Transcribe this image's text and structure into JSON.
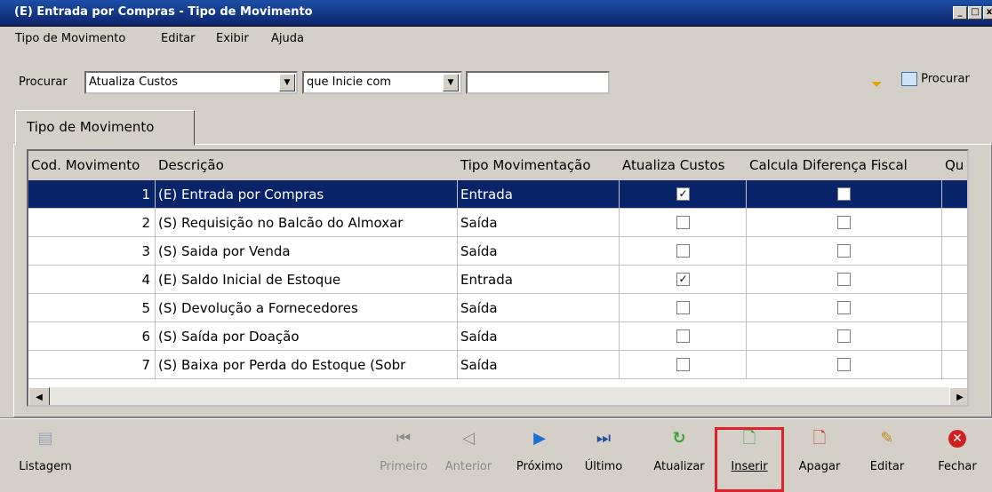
{
  "window": {
    "title": "(E) Entrada por Compras -  Tipo de Movimento"
  },
  "menu": [
    {
      "label": "Tipo de Movimento"
    },
    {
      "label": "Editar"
    },
    {
      "label": "Exibir"
    },
    {
      "label": "Ajuda"
    }
  ],
  "search": {
    "label": "Procurar",
    "field_value": "Atualiza Custos",
    "mode_value": "que Inicie com",
    "text_value": "",
    "button_label": "Procurar"
  },
  "tab": {
    "label": "Tipo de Movimento"
  },
  "grid": {
    "columns": [
      "Cod. Movimento",
      "Descrição",
      "Tipo Movimentação",
      "Atualiza Custos",
      "Calcula Diferença Fiscal",
      "Qu"
    ],
    "rows": [
      {
        "code": "1",
        "desc": "(E) Entrada por Compras",
        "tipo": "Entrada",
        "atualiza": true,
        "calcula": false,
        "selected": true
      },
      {
        "code": "2",
        "desc": "(S) Requisição no Balcão do Almoxar",
        "tipo": "Saída",
        "atualiza": false,
        "calcula": false
      },
      {
        "code": "3",
        "desc": "(S) Saida por Venda",
        "tipo": "Saída",
        "atualiza": false,
        "calcula": false
      },
      {
        "code": "4",
        "desc": "(E) Saldo Inicial de Estoque",
        "tipo": "Entrada",
        "atualiza": true,
        "calcula": false
      },
      {
        "code": "5",
        "desc": "(S) Devolução a Fornecedores",
        "tipo": "Saída",
        "atualiza": false,
        "calcula": false
      },
      {
        "code": "6",
        "desc": "(S) Saída por Doação",
        "tipo": "Saída",
        "atualiza": false,
        "calcula": false
      },
      {
        "code": "7",
        "desc": "(S) Baixa por Perda do Estoque (Sobr",
        "tipo": "Saída",
        "atualiza": false,
        "calcula": false
      }
    ]
  },
  "toolbar": {
    "listagem": "Listagem",
    "primeiro": "Primeiro",
    "anterior": "Anterior",
    "proximo": "Próximo",
    "ultimo": "Último",
    "atualizar": "Atualizar",
    "inserir": "Inserir",
    "apagar": "Apagar",
    "editar": "Editar",
    "fechar": "Fechar"
  },
  "colors": {
    "title_bar": "#0a246a",
    "selection": "#0a246a",
    "highlight_box": "#e0202a"
  }
}
